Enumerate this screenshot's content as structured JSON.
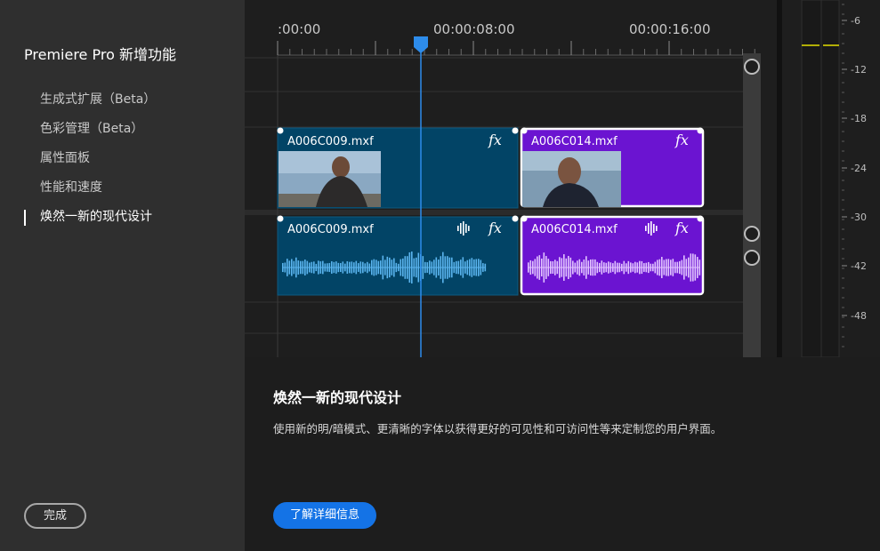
{
  "sidebar": {
    "title": "Premiere Pro 新增功能",
    "items": [
      {
        "label": "生成式扩展（Beta）"
      },
      {
        "label": "色彩管理（Beta）"
      },
      {
        "label": "属性面板"
      },
      {
        "label": "性能和速度"
      },
      {
        "label": "焕然一新的现代设计"
      }
    ],
    "active_index": 4,
    "done_label": "完成"
  },
  "timeline": {
    "timecodes": [
      ":00:00",
      "00:00:08:00",
      "00:00:16:00"
    ],
    "video_clips": [
      {
        "name": "A006C009.mxf",
        "fx": "fx",
        "color": "#024466"
      },
      {
        "name": "A006C014.mxf",
        "fx": "fx",
        "color": "#6b14d1"
      }
    ],
    "audio_clips": [
      {
        "name": "A006C009.mxf",
        "fx": "fx",
        "color": "#024466",
        "wave_color": "#5ab4ee"
      },
      {
        "name": "A006C014.mxf",
        "fx": "fx",
        "color": "#6b14d1",
        "wave_color": "#e2c4ff"
      }
    ],
    "meter_labels": [
      "-6",
      "-12",
      "-18",
      "-24",
      "-30",
      "-42",
      "-48"
    ],
    "playhead_color": "#2d8ceb"
  },
  "content": {
    "title": "焕然一新的现代设计",
    "description": "使用新的明/暗模式、更清晰的字体以获得更好的可见性和可访问性等来定制您的用户界面。",
    "learn_more_label": "了解详细信息"
  }
}
